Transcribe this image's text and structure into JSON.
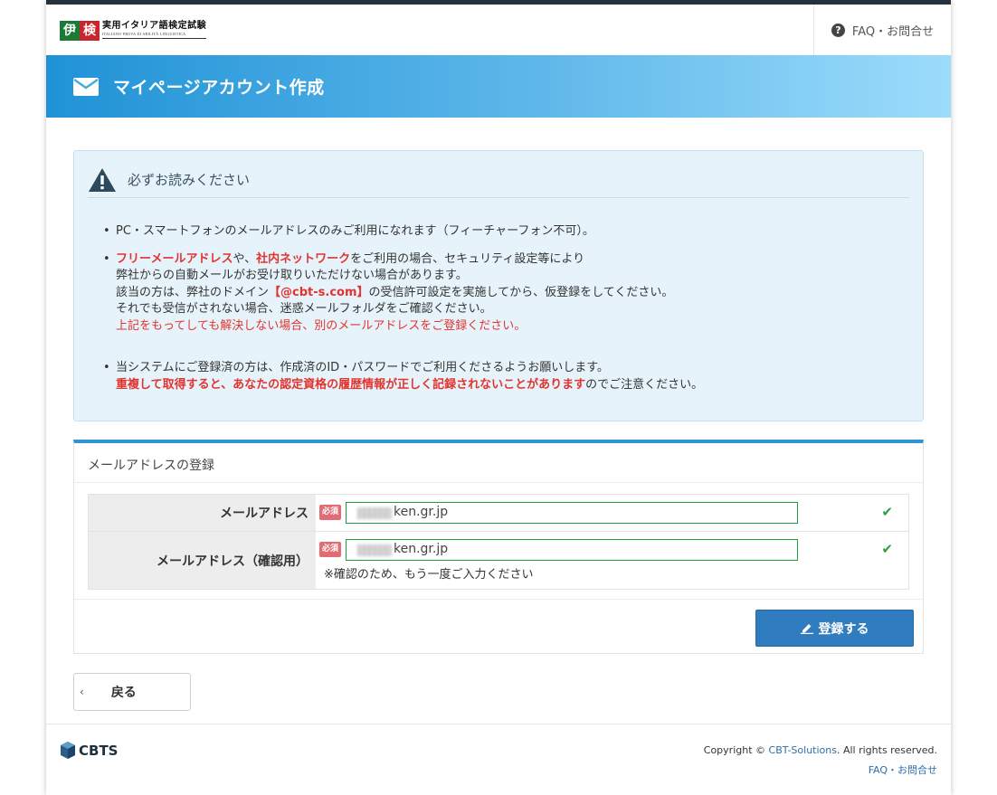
{
  "header": {
    "logo_kanji_1": "伊",
    "logo_kanji_2": "検",
    "logo_title": "実用イタリア語検定試験",
    "logo_subtitle": "ITALIANO·PROVA DI ABILITÀ LINGUISTICA",
    "faq_link": "FAQ・お問合せ"
  },
  "banner": {
    "title": "マイページアカウント作成"
  },
  "notice": {
    "title": "必ずお読みください",
    "item1": "PC・スマートフォンのメールアドレスのみご利用になれます（フィーチャーフォン不可）。",
    "item2_red1": "フリーメールアドレス",
    "item2_t1": "や、",
    "item2_red2": "社内ネットワーク",
    "item2_t2": "をご利用の場合、セキュリティ設定等により",
    "item2_l2": "弊社からの自動メールがお受け取りいただけない場合があります。",
    "item2_l3a": "該当の方は、弊社のドメイン",
    "item2_l3_domain": "【@cbt-s.com】",
    "item2_l3b": "の受信許可設定を実施してから、仮登録をしてください。",
    "item2_l4": "それでも受信がされない場合、迷惑メールフォルダをご確認ください。",
    "item2_l5": "上記をもってしても解決しない場合、別のメールアドレスをご登録ください。",
    "item3_l1": "当システムにご登録済の方は、作成済のID・パスワードでご利用くださるようお願いします。",
    "item3_red": "重複して取得すると、あなたの認定資格の履歴情報が正しく記録されないことがあります",
    "item3_tail": "のでご注意ください。"
  },
  "registration": {
    "title": "メールアドレスの登録",
    "required_badge": "必須",
    "email_label": "メールアドレス",
    "email_value": "ken.gr.jp",
    "confirm_label": "メールアドレス（確認用）",
    "confirm_value": "ken.gr.jp",
    "confirm_hint": "※確認のため、もう一度ご入力ください",
    "check_mark": "✔",
    "submit_label": "登録する"
  },
  "back_button": "戻る",
  "footer": {
    "logo_text": "CBTS",
    "copyright_pre": "Copyright © ",
    "copyright_link": "CBT-Solutions",
    "copyright_post": ". All rights reserved.",
    "faq_link": "FAQ・お問合せ"
  },
  "colors": {
    "accent_blue": "#2f7cbf",
    "banner_start": "#1f92d6",
    "warning_red": "#e2342f",
    "valid_green": "#2e9d44"
  }
}
